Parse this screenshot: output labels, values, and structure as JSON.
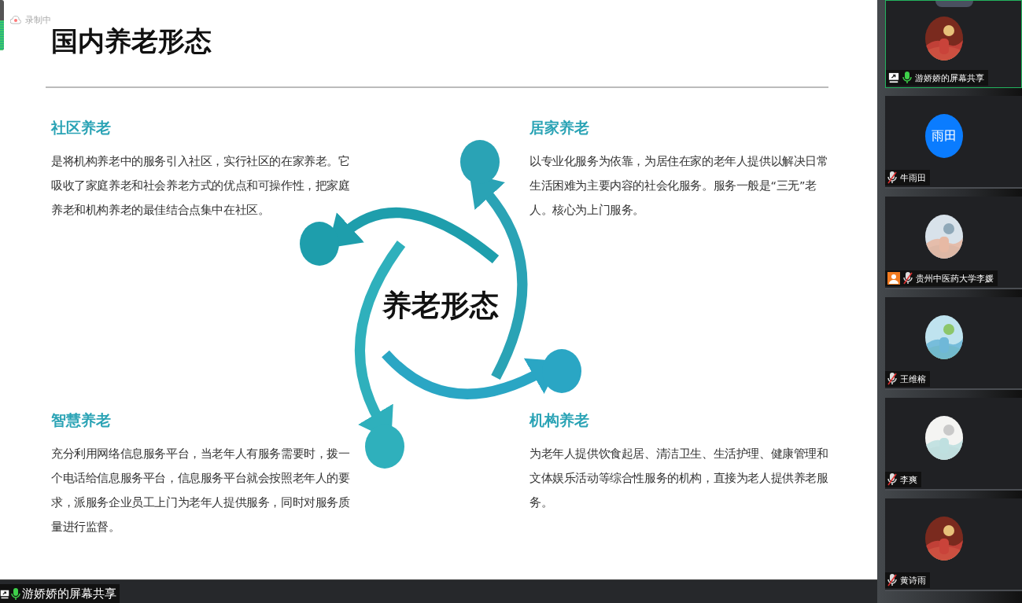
{
  "recording": {
    "label": "录制中",
    "level": 0.6
  },
  "slide": {
    "title": "国内养老形态",
    "center_label": "养老形态",
    "sections": [
      {
        "heading": "社区养老",
        "body": "是将机构养老中的服务引入社区，实行社区的在家养老。它吸收了家庭养老和社会养老方式的优点和可操作性，把家庭养老和机构养老的最佳结合点集中在社区。"
      },
      {
        "heading": "居家养老",
        "body": "以专业化服务为依靠，为居住在家的老年人提供以解决日常生活困难为主要内容的社会化服务。服务一般是“三无”老人。核心为上门服务。"
      },
      {
        "heading": "智慧养老",
        "body": "充分利用网络信息服务平台，当老年人有服务需要时，拨一个电话给信息服务平台，信息服务平台就会按照老年人的要求，派服务企业员工上门为老年人提供服务，同时对服务质量进行监督。"
      },
      {
        "heading": "机构养老",
        "body": "为老年人提供饮食起居、清洁卫生、生活护理、健康管理和文体娱乐活动等综合性服务的机构，直接为老人提供养老服务。"
      }
    ]
  },
  "participants": [
    {
      "name": "游娇娇的屏幕共享",
      "muted": false,
      "sharing": true,
      "badge": false,
      "active": true
    },
    {
      "name": "牛雨田",
      "muted": true,
      "sharing": false,
      "badge": false,
      "active": false,
      "avatar": {
        "kind": "initials",
        "text": "雨田"
      }
    },
    {
      "name": "贵州中医药大学李媛",
      "muted": true,
      "sharing": false,
      "badge": true,
      "active": false
    },
    {
      "name": "王维榕",
      "muted": true,
      "sharing": false,
      "badge": false,
      "active": false
    },
    {
      "name": "李爽",
      "muted": true,
      "sharing": false,
      "badge": false,
      "active": false
    },
    {
      "name": "黄诗雨",
      "muted": true,
      "sharing": false,
      "badge": false,
      "active": false
    }
  ],
  "share_bar": {
    "label": "游娇娇的屏幕共享",
    "muted": false
  }
}
